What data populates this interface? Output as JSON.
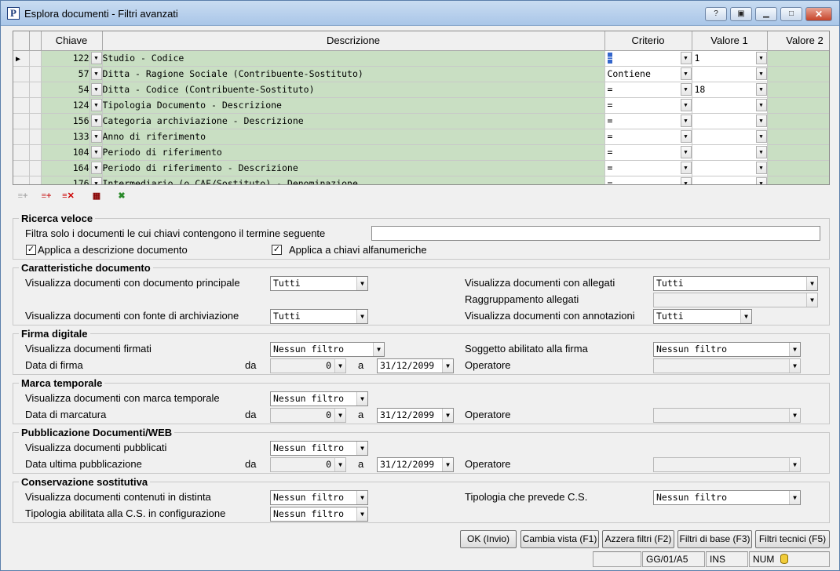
{
  "window": {
    "title": "Esplora documenti - Filtri avanzati",
    "app_icon": "P"
  },
  "grid": {
    "headers": {
      "key": "Chiave",
      "desc": "Descrizione",
      "crit": "Criterio",
      "v1": "Valore 1",
      "v2": "Valore 2"
    },
    "rows": [
      {
        "key": "122",
        "desc": "Studio - Codice",
        "crit": "=",
        "v1": "1",
        "v2": ""
      },
      {
        "key": "57",
        "desc": "Ditta - Ragione Sociale (Contribuente-Sostituto)",
        "crit": "Contiene",
        "v1": "",
        "v2": ""
      },
      {
        "key": "54",
        "desc": "Ditta - Codice  (Contribuente-Sostituto)",
        "crit": "=",
        "v1": "18",
        "v2": ""
      },
      {
        "key": "124",
        "desc": "Tipologia Documento - Descrizione",
        "crit": "=",
        "v1": "",
        "v2": ""
      },
      {
        "key": "156",
        "desc": "Categoria archiviazione - Descrizione",
        "crit": "=",
        "v1": "",
        "v2": ""
      },
      {
        "key": "133",
        "desc": "Anno di riferimento",
        "crit": "=",
        "v1": "",
        "v2": ""
      },
      {
        "key": "104",
        "desc": "Periodo di riferimento",
        "crit": "=",
        "v1": "",
        "v2": ""
      },
      {
        "key": "164",
        "desc": "Periodo di riferimento - Descrizione",
        "crit": "=",
        "v1": "",
        "v2": ""
      },
      {
        "key": "176",
        "desc": "Intermediario (o CAF/Sostituto) - Denominazione",
        "crit": "=",
        "v1": "",
        "v2": ""
      }
    ]
  },
  "quick": {
    "title": "Ricerca veloce",
    "filter_label": "Filtra solo i documenti le cui chiavi contengono il termine seguente",
    "filter_value": "",
    "apply_desc": "Applica a descrizione documento",
    "apply_keys": "Applica a chiavi alfanumeriche"
  },
  "features": {
    "title": "Caratteristiche documento",
    "main_label": "Visualizza documenti con documento principale",
    "main_value": "Tutti",
    "source_label": "Visualizza documenti con fonte di archiviazione",
    "source_value": "Tutti",
    "attach_label": "Visualizza documenti con allegati",
    "attach_value": "Tutti",
    "group_label": "Raggruppamento allegati",
    "group_value": "",
    "notes_label": "Visualizza documenti con annotazioni",
    "notes_value": "Tutti"
  },
  "signature": {
    "title": "Firma digitale",
    "signed_label": "Visualizza documenti firmati",
    "signed_value": "Nessun filtro",
    "date_label": "Data di firma",
    "from": "da",
    "from_value": "0",
    "to": "a",
    "to_value": "31/12/2099",
    "subject_label": "Soggetto abilitato alla firma",
    "subject_value": "Nessun filtro",
    "operator_label": "Operatore"
  },
  "timestamp": {
    "title": "Marca temporale",
    "mark_label": "Visualizza documenti con marca temporale",
    "mark_value": "Nessun filtro",
    "date_label": "Data di marcatura",
    "from": "da",
    "from_value": "0",
    "to": "a",
    "to_value": "31/12/2099",
    "operator_label": "Operatore"
  },
  "publish": {
    "title": "Pubblicazione Documenti/WEB",
    "pub_label": "Visualizza documenti pubblicati",
    "pub_value": "Nessun filtro",
    "date_label": "Data ultima pubblicazione",
    "from": "da",
    "from_value": "0",
    "to": "a",
    "to_value": "31/12/2099",
    "operator_label": "Operatore"
  },
  "conservation": {
    "title": "Conservazione sostitutiva",
    "list_label": "Visualizza documenti contenuti in distinta",
    "list_value": "Nessun filtro",
    "cfg_label": "Tipologia abilitata alla C.S. in configurazione",
    "cfg_value": "Nessun filtro",
    "type_label": "Tipologia che prevede C.S.",
    "type_value": "Nessun filtro"
  },
  "buttons": {
    "ok": "OK (Invio)",
    "view": "Cambia vista (F1)",
    "reset": "Azzera filtri (F2)",
    "basic": "Filtri di base (F3)",
    "tech": "Filtri tecnici (F5)"
  },
  "status": {
    "period": "GG/01/A5",
    "ins": "INS",
    "num": "NUM"
  },
  "colors": {
    "row_bg": "#c9dfc3",
    "title_bar": "#a9c6e8",
    "selection": "#3366cc"
  }
}
